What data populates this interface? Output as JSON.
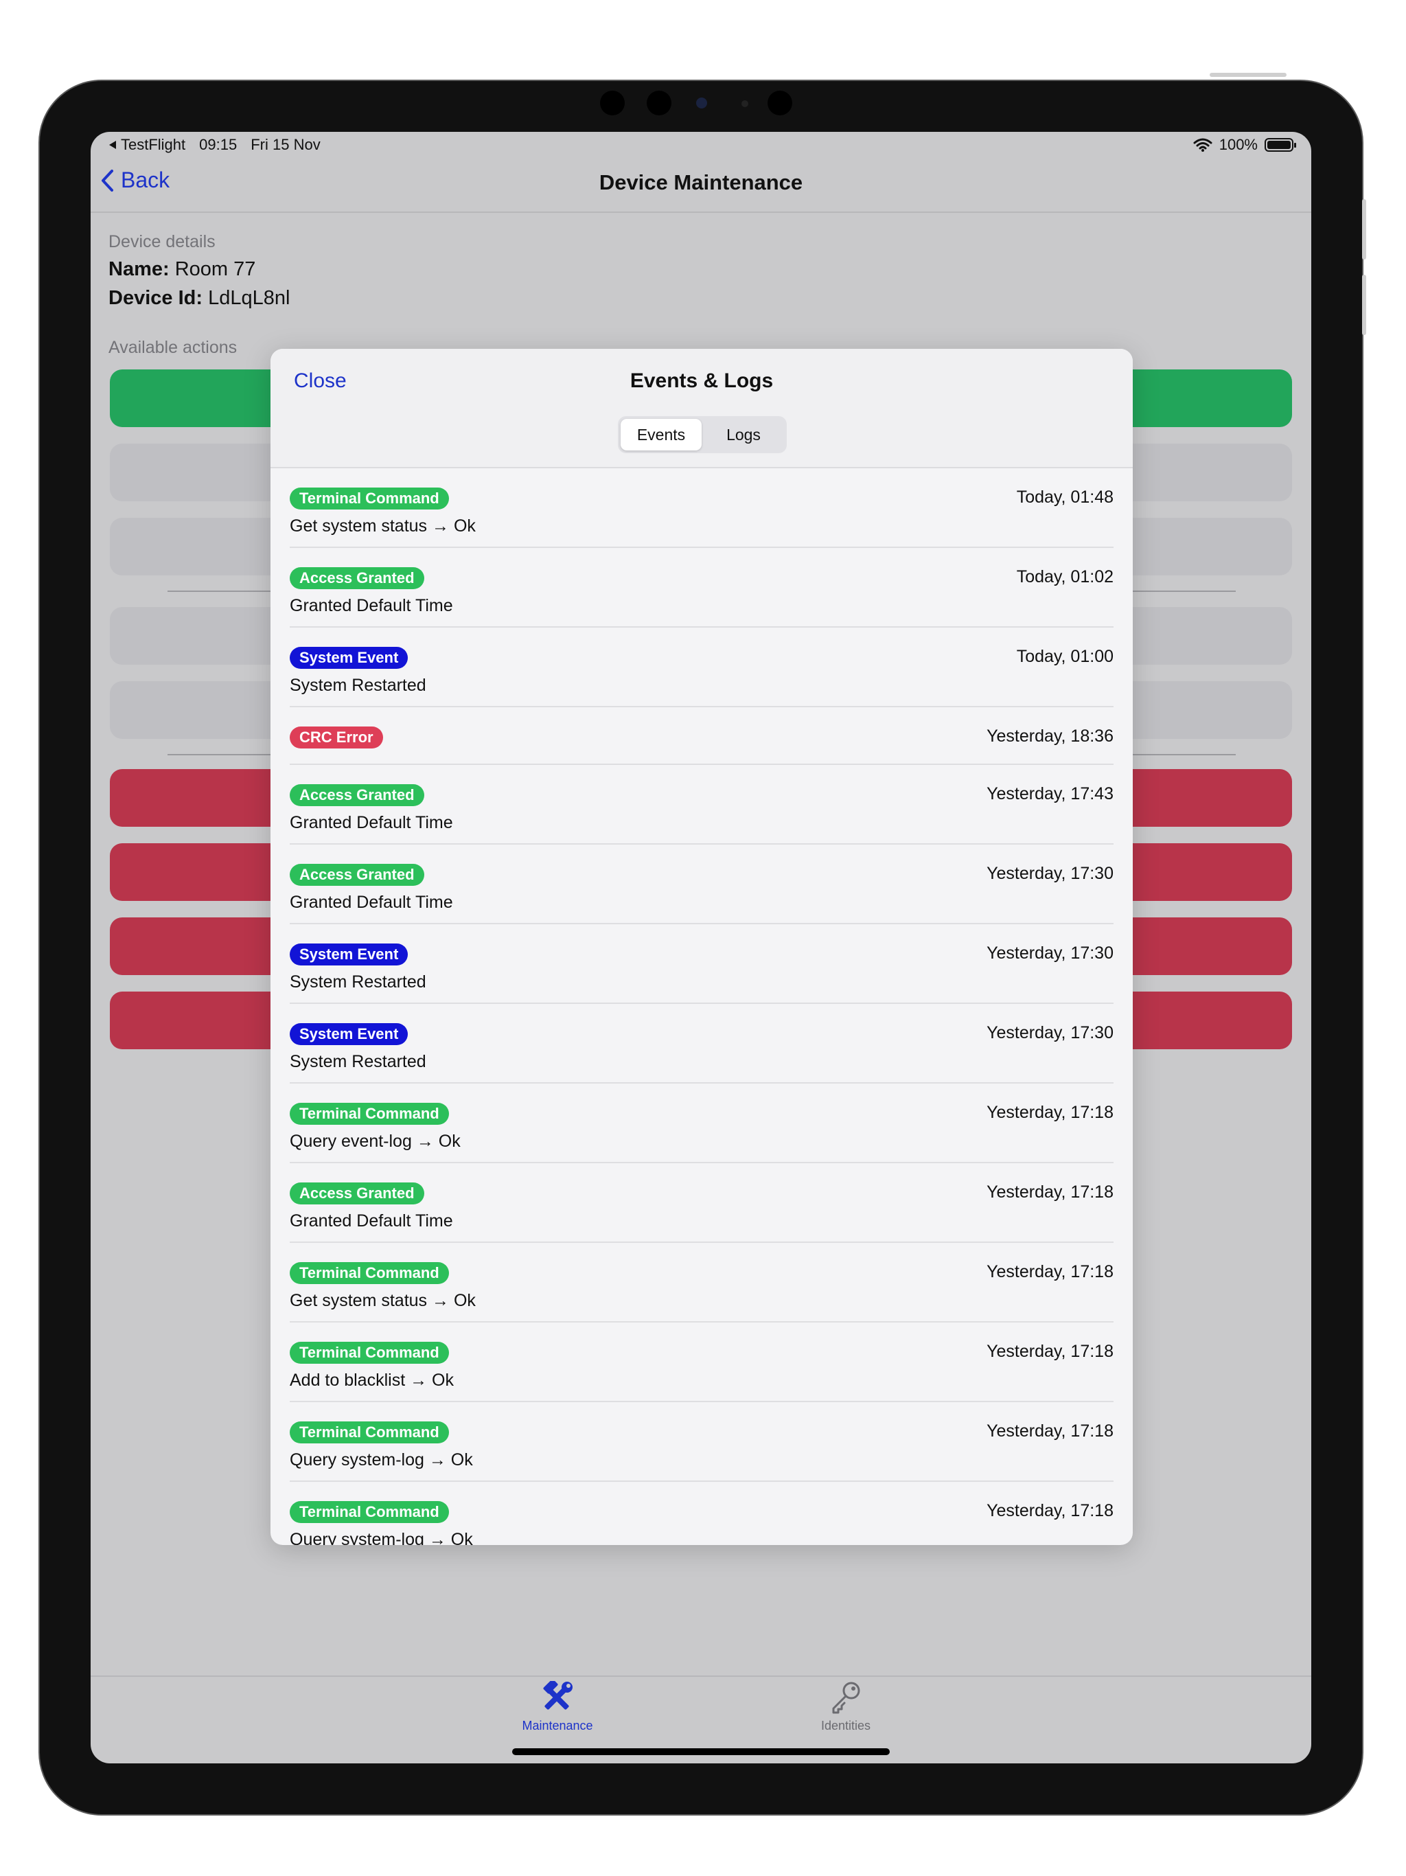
{
  "status_bar": {
    "app": "TestFlight",
    "time": "09:15",
    "date": "Fri 15 Nov",
    "battery": "100%"
  },
  "nav": {
    "back_label": "Back",
    "title": "Device Maintenance"
  },
  "device": {
    "section_label": "Device details",
    "name_label": "Name:",
    "name_value": "Room 77",
    "id_label": "Device Id:",
    "id_value": "LdLqL8nl"
  },
  "actions": {
    "section_label": "Available actions",
    "colors": {
      "primary": "#22a55a",
      "neutral": "#bfbfc3",
      "danger": "#b8344a"
    }
  },
  "modal": {
    "close_label": "Close",
    "title": "Events & Logs",
    "segments": [
      {
        "label": "Events",
        "active": true
      },
      {
        "label": "Logs",
        "active": false
      }
    ],
    "badge_colors": {
      "Terminal Command": "#2cbf5a",
      "Access Granted": "#2cbf5a",
      "System Event": "#1214d6",
      "CRC Error": "#de3e57"
    },
    "events": [
      {
        "type": "Terminal Command",
        "time": "Today, 01:48",
        "description": "Get system status → Ok"
      },
      {
        "type": "Access Granted",
        "time": "Today, 01:02",
        "description": "Granted Default Time"
      },
      {
        "type": "System Event",
        "time": "Today, 01:00",
        "description": "System Restarted"
      },
      {
        "type": "CRC Error",
        "time": "Yesterday, 18:36",
        "description": ""
      },
      {
        "type": "Access Granted",
        "time": "Yesterday, 17:43",
        "description": "Granted Default Time"
      },
      {
        "type": "Access Granted",
        "time": "Yesterday, 17:30",
        "description": "Granted Default Time"
      },
      {
        "type": "System Event",
        "time": "Yesterday, 17:30",
        "description": "System Restarted"
      },
      {
        "type": "System Event",
        "time": "Yesterday, 17:30",
        "description": "System Restarted"
      },
      {
        "type": "Terminal Command",
        "time": "Yesterday, 17:18",
        "description": "Query event-log → Ok"
      },
      {
        "type": "Access Granted",
        "time": "Yesterday, 17:18",
        "description": "Granted Default Time"
      },
      {
        "type": "Terminal Command",
        "time": "Yesterday, 17:18",
        "description": "Get system status → Ok"
      },
      {
        "type": "Terminal Command",
        "time": "Yesterday, 17:18",
        "description": "Add to blacklist → Ok"
      },
      {
        "type": "Terminal Command",
        "time": "Yesterday, 17:18",
        "description": "Query system-log → Ok"
      },
      {
        "type": "Terminal Command",
        "time": "Yesterday, 17:18",
        "description": "Query system-log → Ok"
      }
    ]
  },
  "tabbar": {
    "active_color": "#1d33c9",
    "inactive_color": "#6b6b70",
    "items": [
      {
        "label": "Maintenance",
        "icon": "hammer-wrench-icon",
        "active": true
      },
      {
        "label": "Identities",
        "icon": "key-icon",
        "active": false
      }
    ]
  }
}
